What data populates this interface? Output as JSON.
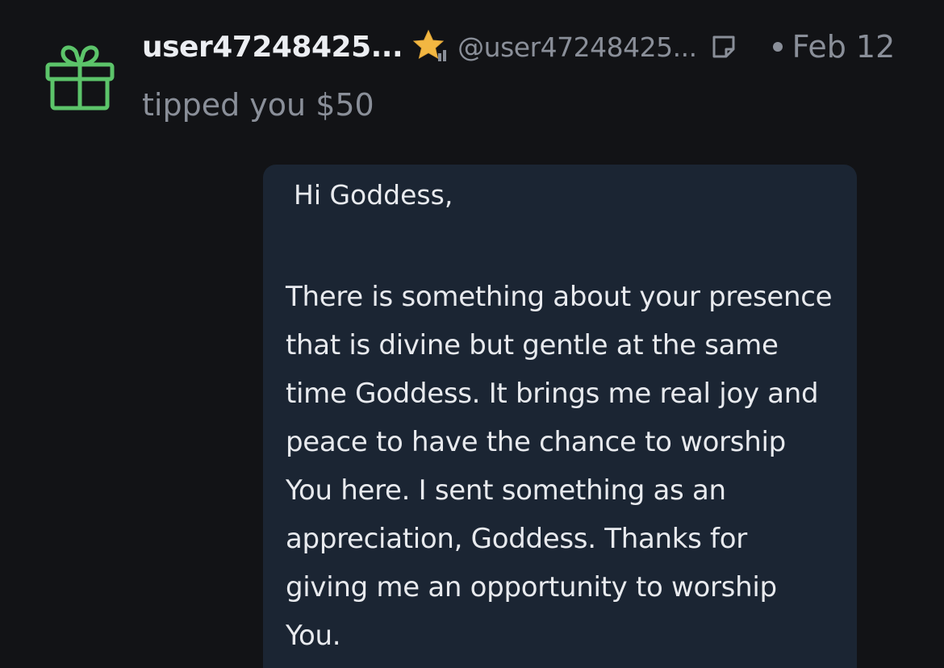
{
  "notification": {
    "icon": "gift-icon",
    "icon_color": "#5cc46a",
    "username": "user47248425...",
    "badge_icon": "star-badge-icon",
    "badge_color": "#f2b742",
    "handle": "@user47248425...",
    "note_icon": "note-icon",
    "date": "Feb 12",
    "tip_text": "tipped you ",
    "tip_amount": "$50"
  },
  "message": {
    "greeting": "Hi Goddess,",
    "lines": [
      "There is something about your presence",
      "that is divine but gentle at the same",
      "time Goddess.  It brings me real joy and",
      "peace to have the chance to worship",
      "You here. I sent something as an",
      "appreciation, Goddess. Thanks for",
      "giving me an opportunity to worship",
      "You."
    ]
  },
  "colors": {
    "background": "#121316",
    "bubble": "#1b2533",
    "muted_text": "#8a8f99"
  }
}
